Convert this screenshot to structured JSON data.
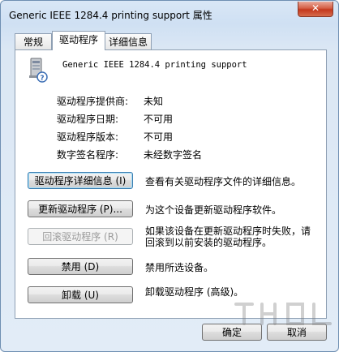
{
  "window": {
    "title": "Generic IEEE 1284.4 printing support 属性",
    "close_label": "✕"
  },
  "tabs": [
    {
      "label": "常规"
    },
    {
      "label": "驱动程序",
      "active": true
    },
    {
      "label": "详细信息"
    }
  ],
  "device": {
    "name": "Generic IEEE 1284.4 printing support",
    "icon": "printer-device-icon"
  },
  "info": [
    {
      "label": "驱动程序提供商:",
      "value": "未知"
    },
    {
      "label": "驱动程序日期:",
      "value": "不可用"
    },
    {
      "label": "驱动程序版本:",
      "value": "不可用"
    },
    {
      "label": "数字签名程序:",
      "value": "未经数字签名"
    }
  ],
  "actions": [
    {
      "button": "驱动程序详细信息 (I)",
      "description": "查看有关驱动程序文件的详细信息。"
    },
    {
      "button": "更新驱动程序 (P)...",
      "description": "为这个设备更新驱动程序软件。"
    },
    {
      "button": "回滚驱动程序 (R)",
      "description": "如果该设备在更新驱动程序时失败，请回滚到以前安装的驱动程序。",
      "disabled": true
    },
    {
      "button": "禁用 (D)",
      "description": "禁用所选设备。"
    },
    {
      "button": "卸载 (U)",
      "description": "卸载驱动程序 (高级)。"
    }
  ],
  "footer": {
    "ok_label": "确定",
    "cancel_label": "取消"
  },
  "colors": {
    "title_bg": "#cfe0f3",
    "close_red": "#c4381d",
    "focus_blue": "#3c7fb1"
  }
}
